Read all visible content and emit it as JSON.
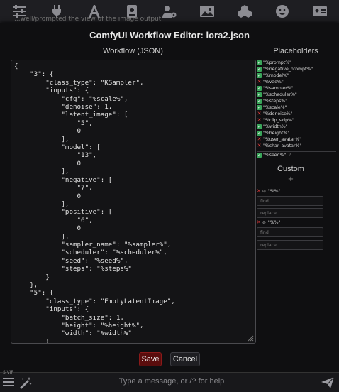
{
  "background": {
    "hint_text": "...well/prompted the view of the image output"
  },
  "toolbar": {
    "icons": [
      "sliders-icon",
      "plug-icon",
      "font-icon",
      "book-icon",
      "user-gear-icon",
      "image-icon",
      "cubes-icon",
      "smiley-icon",
      "id-card-icon"
    ]
  },
  "modal": {
    "title": "ComfyUI Workflow Editor: lora2.json",
    "workflow_label": "Workflow (JSON)",
    "json_text": "{\n    \"3\": {\n        \"class_type\": \"KSampler\",\n        \"inputs\": {\n            \"cfg\": \"%scale%\",\n            \"denoise\": 1,\n            \"latent_image\": [\n                \"5\",\n                0\n            ],\n            \"model\": [\n                \"13\",\n                0\n            ],\n            \"negative\": [\n                \"7\",\n                0\n            ],\n            \"positive\": [\n                \"6\",\n                0\n            ],\n            \"sampler_name\": \"%sampler%\",\n            \"scheduler\": \"%scheduler%\",\n            \"seed\": \"%seed%\",\n            \"steps\": \"%steps%\"\n        }\n    },\n    \"5\": {\n        \"class_type\": \"EmptyLatentImage\",\n        \"inputs\": {\n            \"batch_size\": 1,\n            \"height\": \"%height%\",\n            \"width\": \"%width%\"\n        }",
    "placeholders_label": "Placeholders",
    "placeholders": [
      {
        "name": "\"%prompt%\"",
        "checked": true
      },
      {
        "name": "\"%negative_prompt%\"",
        "checked": true
      },
      {
        "name": "\"%model%\"",
        "checked": true
      },
      {
        "name": "\"%vae%\"",
        "checked": false
      },
      {
        "name": "\"%sampler%\"",
        "checked": true
      },
      {
        "name": "\"%scheduler%\"",
        "checked": true
      },
      {
        "name": "\"%steps%\"",
        "checked": true
      },
      {
        "name": "\"%scale%\"",
        "checked": true
      },
      {
        "name": "\"%denoise%\"",
        "checked": false
      },
      {
        "name": "\"%clip_skip%\"",
        "checked": false
      },
      {
        "name": "\"%width%\"",
        "checked": true
      },
      {
        "name": "\"%height%\"",
        "checked": true
      },
      {
        "name": "\"%user_avatar%\"",
        "checked": false
      },
      {
        "name": "\"%char_avatar%\"",
        "checked": false
      }
    ],
    "seed": {
      "name": "\"%seed%\"",
      "checked": true,
      "hint": "?"
    },
    "custom_label": "Custom",
    "custom_add": "+",
    "custom_entries": [
      {
        "name": "\"%%\"",
        "find_placeholder": "find",
        "replace_placeholder": "replace"
      },
      {
        "name": "\"%%\"",
        "find_placeholder": "find",
        "replace_placeholder": "replace"
      }
    ],
    "save_label": "Save",
    "cancel_label": "Cancel"
  },
  "bottom": {
    "tiny_label": "SIVIP",
    "chat_placeholder": "Type a message, or /? for help"
  }
}
